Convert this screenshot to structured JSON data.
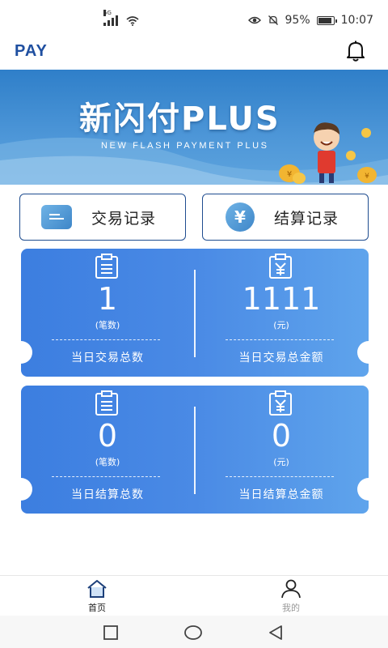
{
  "status_bar": {
    "network_label": "5G",
    "battery_percent": "95%",
    "battery_level": 0.95,
    "time": "10:07"
  },
  "app_bar": {
    "brand": "PAY",
    "bell_icon": "bell-icon"
  },
  "banner": {
    "title": "新闪付PLUS",
    "subtitle": "NEW FLASH PAYMENT PLUS"
  },
  "quick_actions": [
    {
      "label": "交易记录",
      "icon": "card-icon"
    },
    {
      "label": "结算记录",
      "icon": "yuan-coin-icon",
      "glyph": "¥"
    }
  ],
  "stats": {
    "transactions": {
      "count": {
        "value": "1",
        "unit": "(笔数)",
        "caption": "当日交易总数",
        "icon": "clipboard-list-icon"
      },
      "amount": {
        "value": "1111",
        "unit": "(元)",
        "caption": "当日交易总金额",
        "icon": "clipboard-yuan-icon"
      }
    },
    "settlements": {
      "count": {
        "value": "0",
        "unit": "(笔数)",
        "caption": "当日结算总数",
        "icon": "clipboard-list-icon"
      },
      "amount": {
        "value": "0",
        "unit": "(元)",
        "caption": "当日结算总金额",
        "icon": "clipboard-yuan-icon"
      }
    }
  },
  "tab_bar": [
    {
      "label": "首页",
      "icon": "home-icon",
      "active": true
    },
    {
      "label": "我的",
      "icon": "user-icon",
      "active": false
    }
  ],
  "colors": {
    "brand": "#1f4fa0",
    "card_start": "#3c7ee0",
    "card_end": "#5fa4ec",
    "button_border": "#1e4c8f"
  }
}
